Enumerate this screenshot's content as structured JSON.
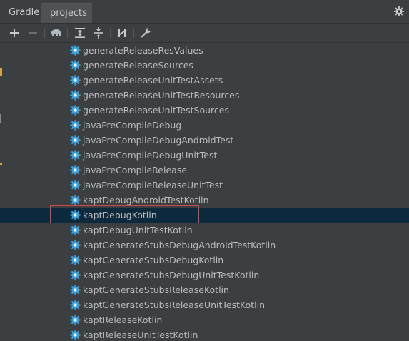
{
  "tabs": {
    "gradle": "Gradle",
    "projects": "projects"
  },
  "toolbar": {
    "items": [
      "add-icon",
      "remove-icon",
      "elephant-icon",
      "expand-all-icon",
      "collapse-all-icon",
      "toggle-offline-icon",
      "wrench-icon"
    ]
  },
  "tasks": [
    "generateReleaseResValues",
    "generateReleaseSources",
    "generateReleaseUnitTestAssets",
    "generateReleaseUnitTestResources",
    "generateReleaseUnitTestSources",
    "javaPreCompileDebug",
    "javaPreCompileDebugAndroidTest",
    "javaPreCompileDebugUnitTest",
    "javaPreCompileRelease",
    "javaPreCompileReleaseUnitTest",
    "kaptDebugAndroidTestKotlin",
    "kaptDebugKotlin",
    "kaptDebugUnitTestKotlin",
    "kaptGenerateStubsDebugAndroidTestKotlin",
    "kaptGenerateStubsDebugKotlin",
    "kaptGenerateStubsDebugUnitTestKotlin",
    "kaptGenerateStubsReleaseKotlin",
    "kaptGenerateStubsReleaseUnitTestKotlin",
    "kaptReleaseKotlin",
    "kaptReleaseUnitTestKotlin"
  ],
  "selected_task": "kaptDebugKotlin",
  "colors": {
    "background": "#3c3f41",
    "selection": "#0d293e",
    "highlight": "#d04a4a",
    "gear": "#3aa0e0"
  }
}
